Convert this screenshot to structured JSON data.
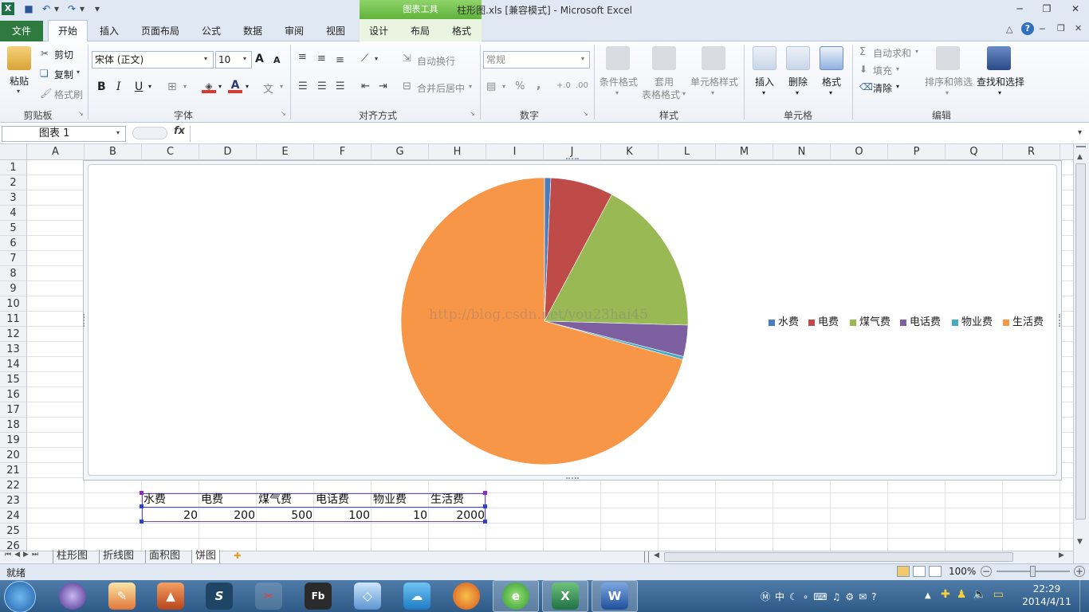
{
  "window": {
    "title": "柱形图.xls  [兼容模式] - Microsoft Excel",
    "context_group": "图表工具"
  },
  "tabs": [
    "文件",
    "开始",
    "插入",
    "页面布局",
    "公式",
    "数据",
    "审阅",
    "视图",
    "设计",
    "布局",
    "格式"
  ],
  "ribbon": {
    "clipboard": {
      "paste": "粘贴",
      "cut": "剪切",
      "copy": "复制",
      "format_painter": "格式刷",
      "label": "剪贴板"
    },
    "font": {
      "name": "宋体 (正文)",
      "size": "10",
      "grow": "A",
      "shrink": "A",
      "bold": "B",
      "italic": "I",
      "underline": "U",
      "label": "字体"
    },
    "alignment": {
      "wrap": "自动换行",
      "merge": "合并后居中",
      "label": "对齐方式"
    },
    "number": {
      "format": "常规",
      "percent": "%",
      "comma": ",",
      "label": "数字"
    },
    "styles": {
      "conditional": "条件格式",
      "table_1": "套用",
      "table_2": "表格格式",
      "cell_styles": "单元格样式",
      "label": "样式"
    },
    "cells": {
      "insert": "插入",
      "delete": "删除",
      "format": "格式",
      "label": "单元格"
    },
    "editing": {
      "autosum": "自动求和",
      "fill": "填充",
      "clear": "清除",
      "sort": "排序和筛选",
      "find": "查找和选择",
      "label": "编辑"
    }
  },
  "formula_bar": {
    "name_box": "图表 1",
    "fx": "fx",
    "value": ""
  },
  "columns": [
    "A",
    "B",
    "C",
    "D",
    "E",
    "F",
    "G",
    "H",
    "I",
    "J",
    "K",
    "L",
    "M",
    "N",
    "O",
    "P",
    "Q",
    "R"
  ],
  "rows": [
    "1",
    "2",
    "3",
    "4",
    "5",
    "6",
    "7",
    "8",
    "9",
    "10",
    "11",
    "12",
    "13",
    "14",
    "15",
    "16",
    "17",
    "18",
    "19",
    "20",
    "21",
    "22",
    "23",
    "24",
    "25",
    "26"
  ],
  "table": {
    "headers": [
      "水费",
      "电费",
      "煤气费",
      "电话费",
      "物业费",
      "生活费"
    ],
    "values": [
      "20",
      "200",
      "500",
      "100",
      "10",
      "2000"
    ]
  },
  "chart_data": {
    "type": "pie",
    "categories": [
      "水费",
      "电费",
      "煤气费",
      "电话费",
      "物业费",
      "生活费"
    ],
    "values": [
      20,
      200,
      500,
      100,
      10,
      2000
    ],
    "colors": [
      "#4a7dbd",
      "#be4b48",
      "#98b954",
      "#7d60a0",
      "#46aac5",
      "#f79646"
    ],
    "legend_position": "right"
  },
  "watermark": "http://blog.csdn.net/you23hai45",
  "sheet_tabs": [
    "柱形图",
    "折线图",
    "面积图",
    "饼图"
  ],
  "active_sheet": "饼图",
  "status": {
    "ready": "就绪",
    "zoom": "100%"
  },
  "clock": {
    "time": "22:29",
    "date": "2014/4/11"
  }
}
